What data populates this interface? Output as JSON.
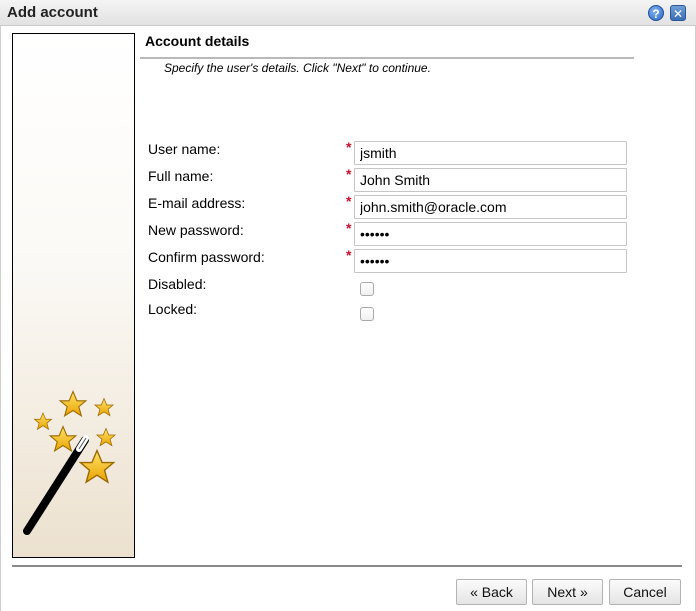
{
  "window": {
    "title": "Add account",
    "help_glyph": "?",
    "close_glyph": "✕"
  },
  "section": {
    "title": "Account details",
    "instructions": "Specify the user's details. Click \"Next\" to continue."
  },
  "form": {
    "required_marker": "*",
    "fields": [
      {
        "label": "User name:",
        "value": "jsmith"
      },
      {
        "label": "Full name:",
        "value": "John Smith"
      },
      {
        "label": "E-mail address:",
        "value": "john.smith@oracle.com"
      },
      {
        "label": "New password:",
        "value": "••••••"
      },
      {
        "label": "Confirm password:",
        "value": "••••••"
      }
    ],
    "checkboxes": [
      {
        "label": "Disabled:",
        "checked": false
      },
      {
        "label": "Locked:",
        "checked": false
      }
    ]
  },
  "buttons": {
    "back": "« Back",
    "next": "Next »",
    "cancel": "Cancel"
  },
  "colors": {
    "required": "#c8102e",
    "star": "#f5b80f",
    "panel_gradient_end": "#ece1cf"
  },
  "icons": {
    "wizard": "magic-wand-stars-icon",
    "help": "help-icon",
    "close": "close-icon"
  }
}
